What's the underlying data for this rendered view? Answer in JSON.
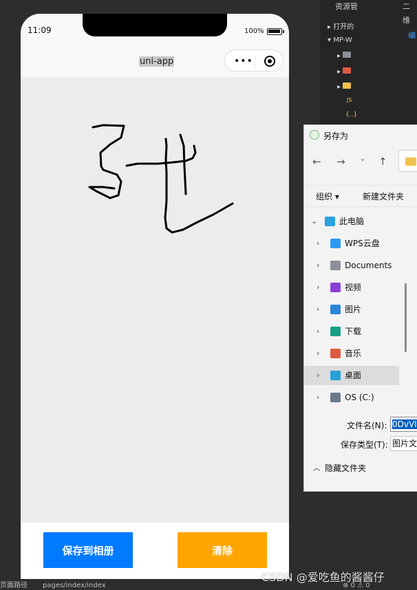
{
  "ide": {
    "tab_resources": "资源管",
    "tab_second": "二维",
    "edit_link": "编",
    "tree_open": "打开的",
    "tree_project": "MP-W",
    "json_badge": "JS",
    "braces": "{..}"
  },
  "phone": {
    "time": "11:09",
    "battery_text": "100%",
    "battery_level": 1.0,
    "nav_title": "uni-app",
    "capsule_dots": "•••",
    "buttons": {
      "save": "保存到相册",
      "clear": "清除"
    },
    "colors": {
      "save": "#007aff",
      "clear": "#ffa500",
      "canvas": "#ececec"
    }
  },
  "dialog": {
    "title": "另存为",
    "nav": {
      "back": "←",
      "forward": "→",
      "dropdown": "˅",
      "up": "↑"
    },
    "toolbar": {
      "organize": "组织 ▾",
      "new_folder": "新建文件夹"
    },
    "tree": [
      {
        "label": "此电脑",
        "icon": "computer-icon",
        "color": "#2aa2de",
        "expanded": true
      },
      {
        "label": "WPS云盘",
        "icon": "cloud-icon",
        "color": "#2b9af3"
      },
      {
        "label": "Documents",
        "icon": "documents-icon",
        "color": "#8a8f99"
      },
      {
        "label": "视频",
        "icon": "video-icon",
        "color": "#8b3fd9"
      },
      {
        "label": "图片",
        "icon": "pictures-icon",
        "color": "#2b86d8"
      },
      {
        "label": "下载",
        "icon": "download-icon",
        "color": "#16a085"
      },
      {
        "label": "音乐",
        "icon": "music-icon",
        "color": "#e05a43"
      },
      {
        "label": "桌面",
        "icon": "desktop-icon",
        "color": "#27a1d8",
        "selected": true
      },
      {
        "label": "OS (C:)",
        "icon": "drive-icon",
        "color": "#6b7a8a"
      }
    ],
    "filename_label": "文件名(N):",
    "filename_value": "0DvVI",
    "filetype_label": "保存类型(T):",
    "filetype_value": "图片文",
    "hide_folders": "隐藏文件夹"
  },
  "statusbar": {
    "page_path_label": "页面路径",
    "page_path": "pages/index/index",
    "counts": "⊗ 0 ⚠ 0"
  },
  "watermark": "CSDN @爱吃鱼的酱酱仔"
}
